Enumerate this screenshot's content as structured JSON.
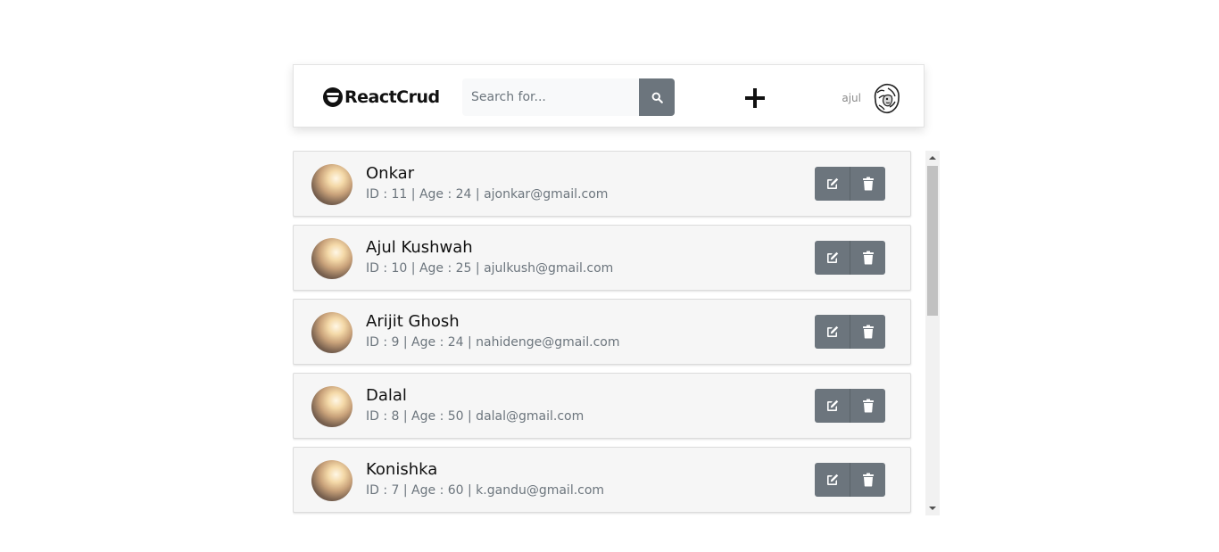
{
  "navbar": {
    "brand": "ReactCrud",
    "search_placeholder": "Search for...",
    "search_icon": "search-icon",
    "add_icon": "plus-icon",
    "user_name": "ajul",
    "user_avatar_icon": "lion-avatar"
  },
  "users": [
    {
      "name": "Onkar",
      "meta": "ID : 11 | Age : 24 | ajonkar@gmail.com"
    },
    {
      "name": "Ajul Kushwah",
      "meta": "ID : 10 | Age : 25 | ajulkush@gmail.com"
    },
    {
      "name": "Arijit Ghosh",
      "meta": "ID : 9 | Age : 24 | nahidenge@gmail.com"
    },
    {
      "name": "Dalal",
      "meta": "ID : 8 | Age : 50 | dalal@gmail.com"
    },
    {
      "name": "Konishka",
      "meta": "ID : 7 | Age : 60 | k.gandu@gmail.com"
    }
  ],
  "row_actions": {
    "edit_icon": "edit-icon",
    "delete_icon": "trash-icon"
  },
  "colors": {
    "button_bg": "#6c757d",
    "card_bg": "#f6f6f6",
    "meta_text": "#6c757d"
  }
}
